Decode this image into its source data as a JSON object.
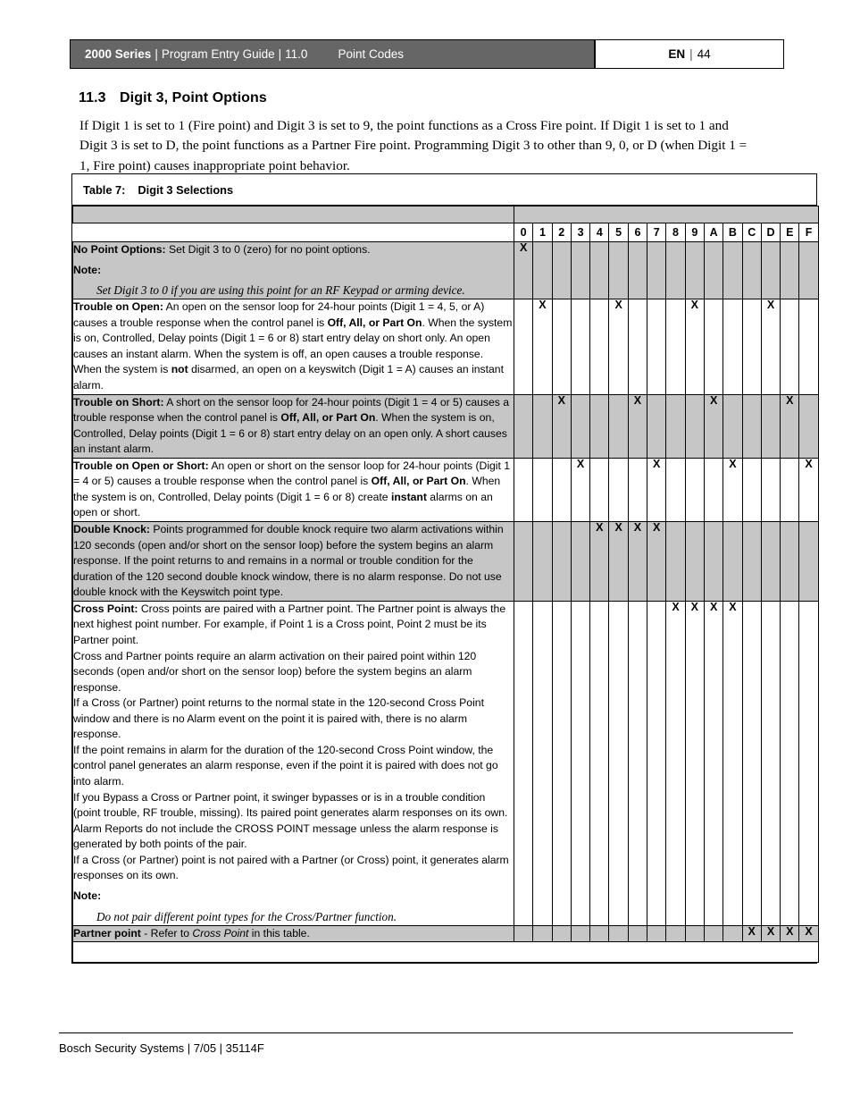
{
  "header": {
    "series": "2000 Series",
    "separator": "|",
    "guide": "Program Entry Guide",
    "version": "11.0",
    "section": "Point Codes",
    "language": "EN",
    "page": "44"
  },
  "section": {
    "number": "11.3",
    "title": "Digit 3, Point Options",
    "intro": "If Digit 1 is set to 1 (Fire point) and Digit 3 is set to 9, the point functions as a Cross Fire point. If Digit 1 is set to 1 and Digit 3 is set to D, the point functions as a Partner Fire point. Programming Digit 3 to other than 9, 0, or D (when Digit 1 = 1, Fire point) causes inappropriate point behavior."
  },
  "table": {
    "caption_label": "Table 7:",
    "caption_title": "Digit 3 Selections",
    "columns": [
      "0",
      "1",
      "2",
      "3",
      "4",
      "5",
      "6",
      "7",
      "8",
      "9",
      "A",
      "B",
      "C",
      "D",
      "E",
      "F"
    ],
    "mark": "X",
    "rows": [
      {
        "id": "no-point-options",
        "shaded": true,
        "title": "No Point Options:",
        "body": " Set Digit 3 to 0 (zero) for no point options.",
        "note_label": "Note:",
        "note_body": "Set Digit 3 to 0 if you are using this point for an RF Keypad or arming device.",
        "marks": [
          "0"
        ]
      },
      {
        "id": "trouble-on-open",
        "shaded": false,
        "title": "Trouble on Open:",
        "body": " An open on the sensor loop for 24-hour points (Digit 1 =  4, 5, or A) causes a trouble response when the control panel is Off, All, or Part On. When the system is on, Controlled, Delay points (Digit 1 = 6 or 8) start entry delay on short only. An open causes an instant alarm. When the system is off, an open causes a trouble response.",
        "body2": "When the system is not disarmed, an open on a keyswitch (Digit 1 = A) causes an instant alarm.",
        "marks": [
          "1",
          "5",
          "9",
          "D"
        ]
      },
      {
        "id": "trouble-on-short",
        "shaded": true,
        "title": "Trouble on Short:",
        "body": " A short on the sensor loop for 24-hour points (Digit 1 = 4 or 5) causes a trouble response when the control panel is Off, All, or Part On. When the system is on, Controlled, Delay points (Digit 1 = 6 or 8) start entry delay on an open only. A short causes an instant alarm.",
        "marks": [
          "2",
          "6",
          "A",
          "E"
        ]
      },
      {
        "id": "trouble-on-open-or-short",
        "shaded": false,
        "title": "Trouble on Open or Short:",
        "body": " An open or short on the sensor loop for 24-hour points (Digit 1 = 4 or 5) causes a trouble response when the control panel is Off, All, or Part On. When the system is on, Controlled, Delay points (Digit 1 = 6 or 8) create instant alarms on an open or short.",
        "marks": [
          "3",
          "7",
          "B",
          "F"
        ]
      },
      {
        "id": "double-knock",
        "shaded": true,
        "title": "Double Knock:",
        "body": " Points programmed for double knock require two alarm activations within 120 seconds (open and/or short on the sensor loop) before the system begins an alarm response. If the point returns to and remains in a normal or trouble condition for the duration of the 120 second double knock window, there is no alarm response. Do not use double knock with the Keyswitch point type.",
        "marks": [
          "4",
          "5",
          "6",
          "7"
        ]
      },
      {
        "id": "cross-point",
        "shaded": false,
        "title": "Cross Point:",
        "body": " Cross points are paired with a Partner point. The Partner point is always the next highest point number. For example, if Point 1 is a Cross point, Point 2 must be its Partner point.",
        "paragraphs": [
          "Cross and Partner points require an alarm activation on their paired point within 120 seconds (open and/or short on the sensor loop) before the system begins an alarm response.",
          "If a Cross (or Partner) point returns to the normal state in the 120-second Cross Point window and there is no Alarm event on the point it is paired with, there is no alarm response.",
          "If the point remains in alarm for the duration of the 120-second Cross Point window, the control panel generates an alarm response, even if the point it is paired with does not go into alarm.",
          "If you Bypass a Cross or Partner point, it swinger bypasses or is in a trouble condition (point trouble, RF trouble, missing). Its paired point generates alarm responses on its own.",
          "Alarm Reports do not include the CROSS POINT message unless the alarm response is generated by both points of the pair.",
          "If a Cross (or Partner) point is not paired with a Partner (or Cross) point, it generates alarm responses on its own."
        ],
        "note_label": "Note:",
        "note_body": "Do not pair different point types for the Cross/Partner function.",
        "marks": [
          "8",
          "9",
          "A",
          "B"
        ]
      },
      {
        "id": "partner-point",
        "shaded": true,
        "title": "Partner point",
        "body": " - Refer to ",
        "body_italic": "Cross Point",
        "body_tail": " in this table.",
        "marks": [
          "C",
          "D",
          "E",
          "F"
        ]
      }
    ]
  },
  "footer": {
    "text": "Bosch Security Systems | 7/05 | 35114F"
  }
}
